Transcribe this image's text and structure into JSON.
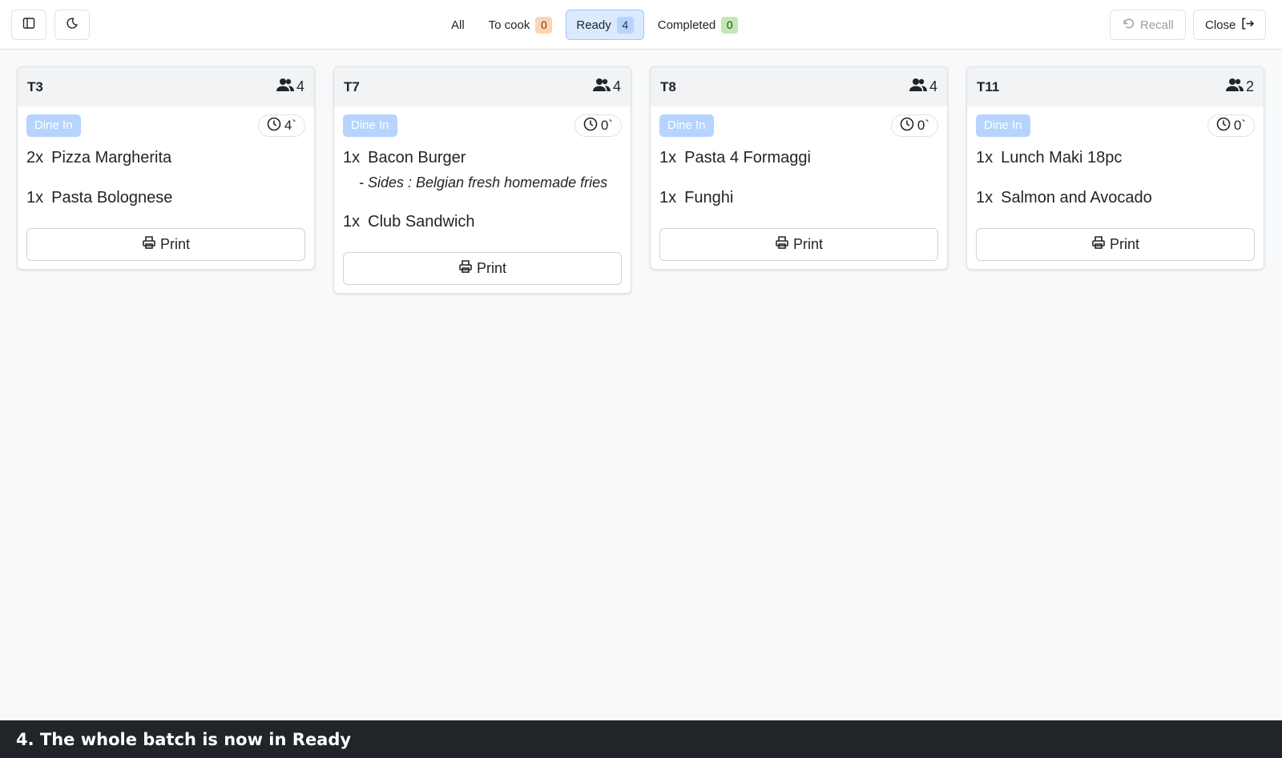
{
  "toolbar": {
    "filters": [
      {
        "label": "All",
        "count": null
      },
      {
        "label": "To cook",
        "count": "0",
        "color": "#fbd5b5"
      },
      {
        "label": "Ready",
        "count": "4",
        "color": "#b6d4fe",
        "active": true
      },
      {
        "label": "Completed",
        "count": "0",
        "color": "#c3e6b5"
      }
    ],
    "recall_label": "Recall",
    "close_label": "Close"
  },
  "orders": [
    {
      "table": "T3",
      "guests": "4",
      "type": "Dine In",
      "elapsed": "4`",
      "items": [
        {
          "qty": "2x",
          "name": "Pizza Margherita"
        },
        {
          "qty": "1x",
          "name": "Pasta Bolognese"
        }
      ],
      "print_label": "Print"
    },
    {
      "table": "T7",
      "guests": "4",
      "type": "Dine In",
      "elapsed": "0`",
      "items": [
        {
          "qty": "1x",
          "name": "Bacon Burger",
          "modifier": "- Sides : Belgian fresh homemade fries"
        },
        {
          "qty": "1x",
          "name": "Club Sandwich"
        }
      ],
      "print_label": "Print"
    },
    {
      "table": "T8",
      "guests": "4",
      "type": "Dine In",
      "elapsed": "0`",
      "items": [
        {
          "qty": "1x",
          "name": "Pasta 4 Formaggi"
        },
        {
          "qty": "1x",
          "name": "Funghi"
        }
      ],
      "print_label": "Print"
    },
    {
      "table": "T11",
      "guests": "2",
      "type": "Dine In",
      "elapsed": "0`",
      "items": [
        {
          "qty": "1x",
          "name": "Lunch Maki 18pc"
        },
        {
          "qty": "1x",
          "name": "Salmon and Avocado"
        }
      ],
      "print_label": "Print"
    }
  ],
  "caption": "4. The whole batch is now in Ready",
  "colors": {
    "accent": "#b6d4fe",
    "active_filter_bg": "#dbeafe",
    "caption_bg": "#212529"
  }
}
